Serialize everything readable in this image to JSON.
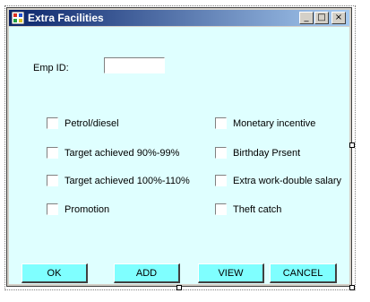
{
  "window": {
    "title": "Extra Facilities",
    "minimize_glyph": "_",
    "maximize_glyph": "□",
    "close_glyph": "×"
  },
  "form": {
    "emp_id_label": "Emp ID:",
    "emp_id_value": ""
  },
  "checkboxes_left": [
    {
      "label": "Petrol/diesel",
      "checked": false
    },
    {
      "label": "Target achieved 90%-99%",
      "checked": false
    },
    {
      "label": "Target achieved 100%-110%",
      "checked": false
    },
    {
      "label": "Promotion",
      "checked": false
    }
  ],
  "checkboxes_right": [
    {
      "label": "Monetary incentive",
      "checked": false
    },
    {
      "label": "Birthday Prsent",
      "checked": false
    },
    {
      "label": "Extra work-double salary",
      "checked": false
    },
    {
      "label": "Theft catch",
      "checked": false
    }
  ],
  "buttons": {
    "ok": "OK",
    "add": "ADD",
    "view": "VIEW",
    "cancel": "CANCEL"
  },
  "colors": {
    "client_bg": "#dfffff",
    "button_bg": "#7fffff",
    "titlebar_start": "#0a246a",
    "titlebar_end": "#a6caf0"
  }
}
